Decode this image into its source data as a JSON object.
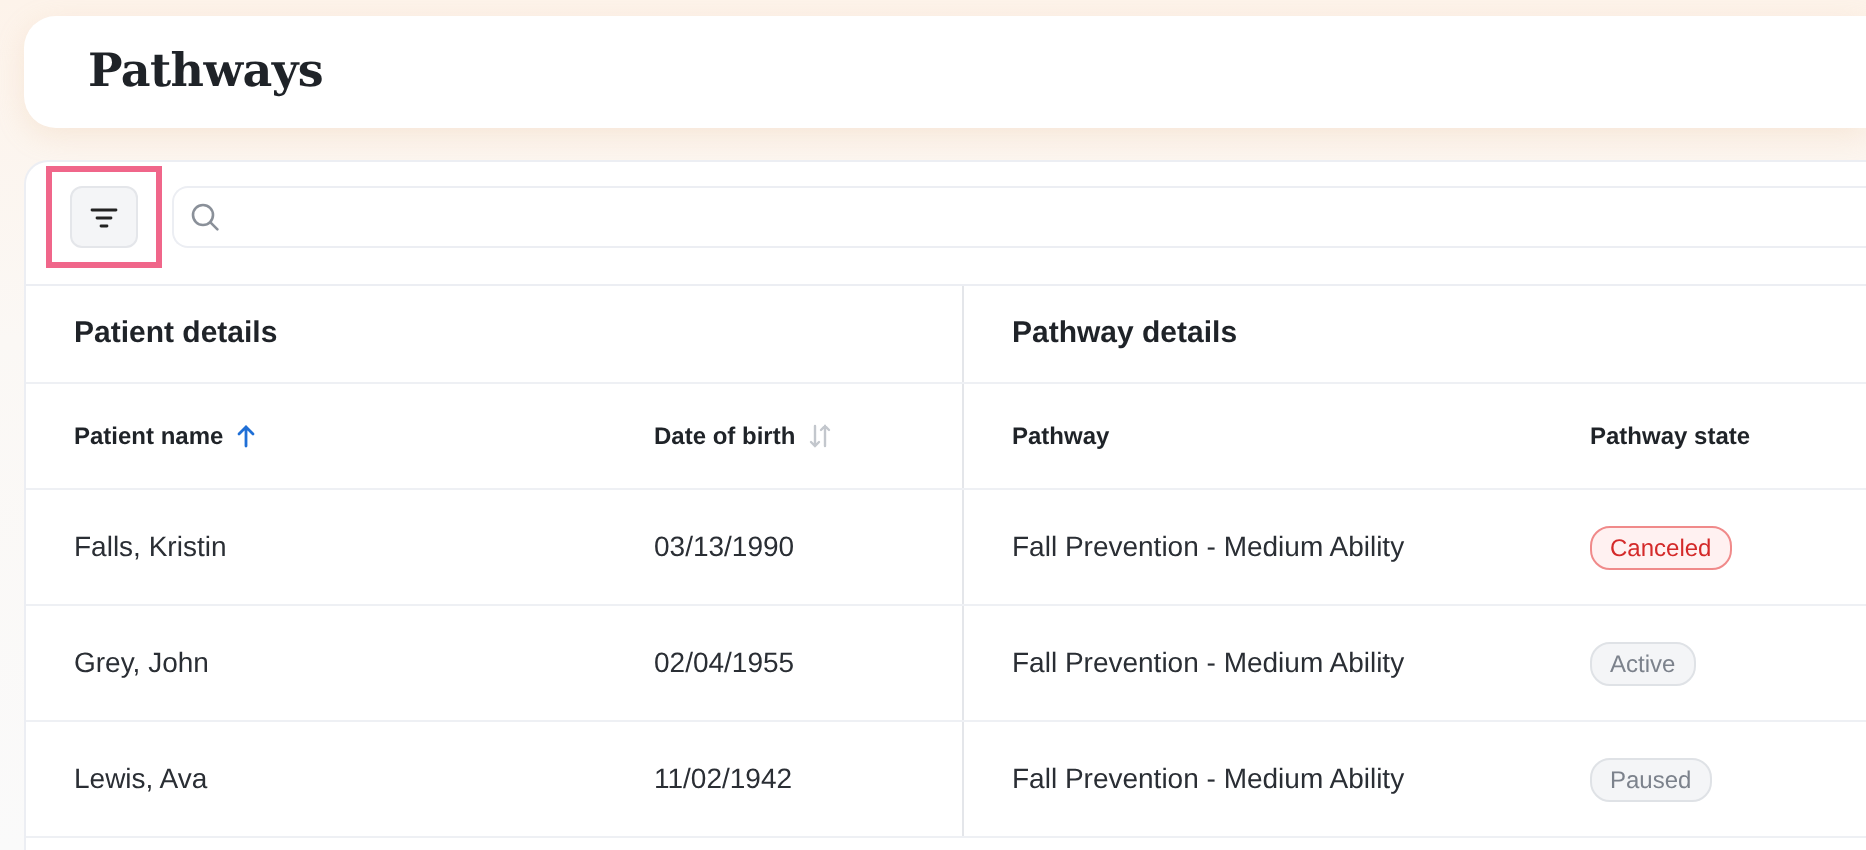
{
  "page_title": "Pathways",
  "toolbar": {
    "filter_button": {
      "highlighted": true
    }
  },
  "groups": [
    {
      "title": "Patient details"
    },
    {
      "title": "Pathway details"
    }
  ],
  "columns": [
    {
      "label": "Patient name",
      "sortable": true,
      "sorted": true
    },
    {
      "label": "Date of birth",
      "sortable": true,
      "sorted": false
    },
    {
      "label": "Pathway",
      "sortable": false
    },
    {
      "label": "Pathway state",
      "sortable": false
    }
  ],
  "rows": [
    {
      "patient_name": "Falls, Kristin",
      "date_of_birth": "03/13/1990",
      "pathway": "Fall Prevention - Medium Ability",
      "state": {
        "label": "Canceled",
        "kind": "canceled"
      }
    },
    {
      "patient_name": "Grey, John",
      "date_of_birth": "02/04/1955",
      "pathway": "Fall Prevention - Medium Ability",
      "state": {
        "label": "Active",
        "kind": "active"
      }
    },
    {
      "patient_name": "Lewis, Ava",
      "date_of_birth": "11/02/1942",
      "pathway": "Fall Prevention - Medium Ability",
      "state": {
        "label": "Paused",
        "kind": "paused"
      }
    }
  ]
}
